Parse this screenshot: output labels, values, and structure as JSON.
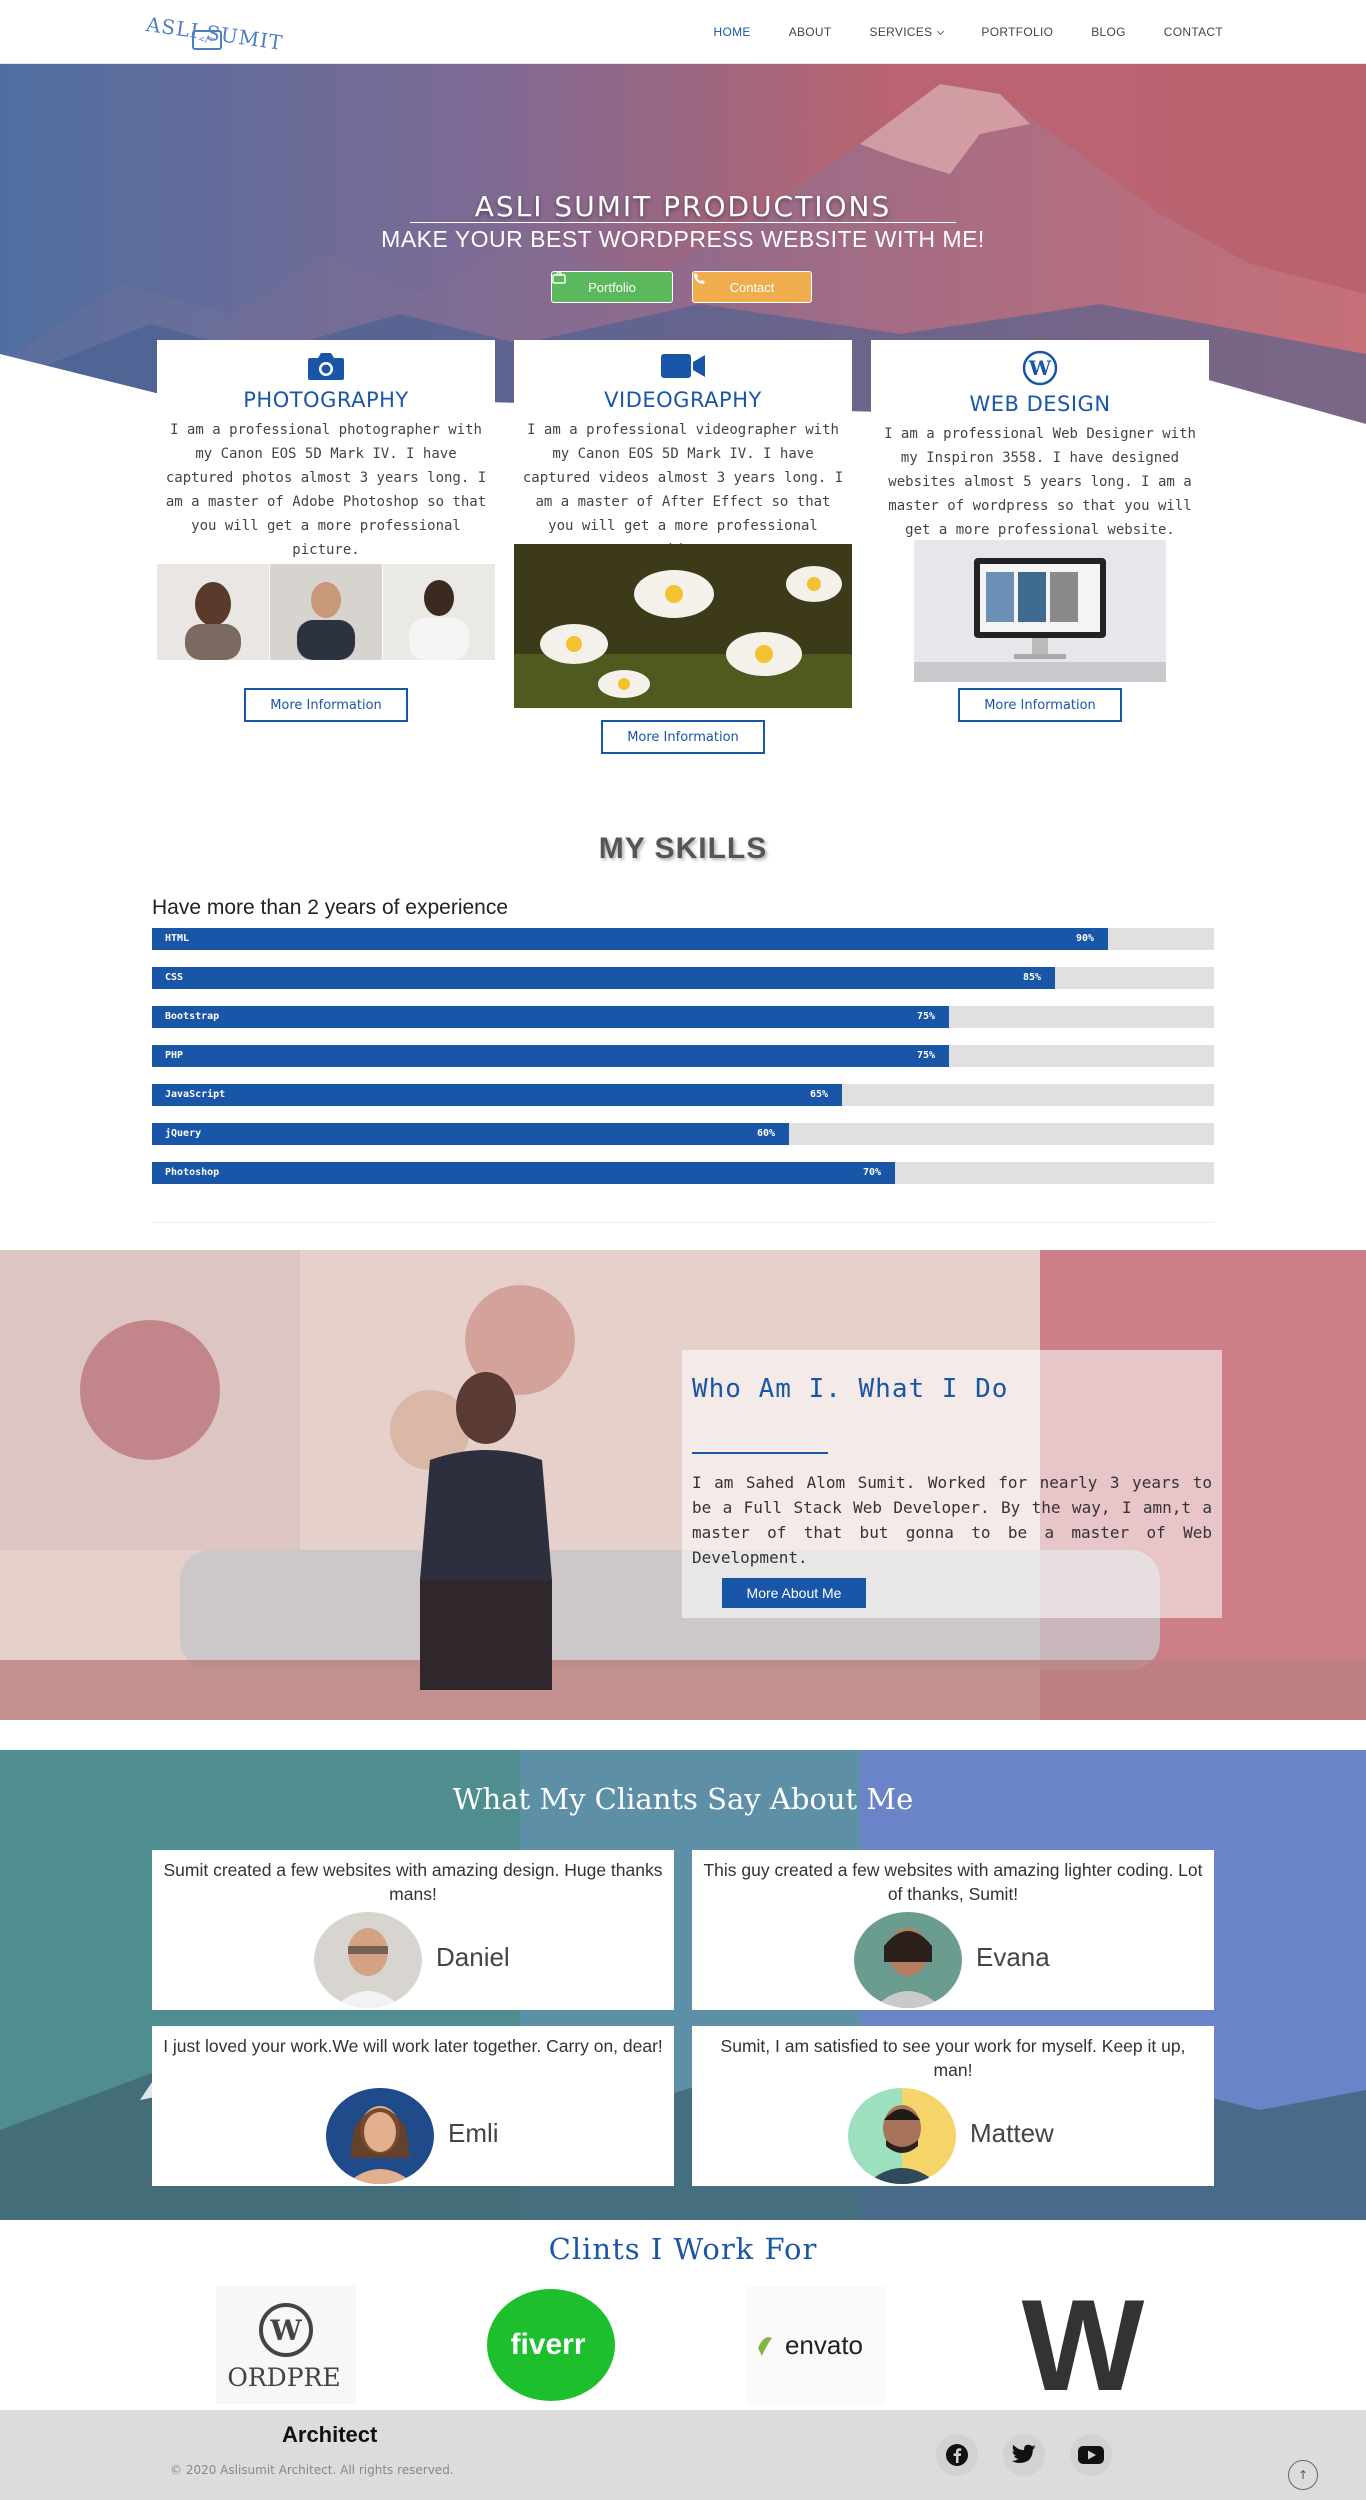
{
  "header": {
    "logo_text": "ASLI SUMIT",
    "logo_mark": "</>",
    "nav": [
      {
        "label": "HOME",
        "active": true
      },
      {
        "label": "ABOUT"
      },
      {
        "label": "SERVICES",
        "dropdown": true
      },
      {
        "label": "PORTFOLIO"
      },
      {
        "label": "BLOG"
      },
      {
        "label": "CONTACT"
      }
    ]
  },
  "hero": {
    "title": "ASLI SUMIT PRODUCTIONS",
    "subtitle": "MAKE YOUR BEST WORDPRESS WEBSITE WITH ME!",
    "portfolio_label": "Portfolio",
    "contact_label": "Contact"
  },
  "services": [
    {
      "icon": "camera-icon",
      "title": "PHOTOGRAPHY",
      "text": "I am a professional photographer with my Canon EOS 5D Mark IV. I have captured photos almost 3 years long. I am a master of Adobe Photoshop so that you will get a more professional picture.",
      "button": "More Information"
    },
    {
      "icon": "video-camera-icon",
      "title": "VIDEOGRAPHY",
      "text": "I am a professional videographer with my Canon EOS 5D Mark IV. I have captured videos almost 3 years long. I am a master of After Effect so that you will get a more professional video.",
      "button": "More Information"
    },
    {
      "icon": "wordpress-icon",
      "title": "WEB DESIGN",
      "text": "I am a professional Web Designer with my Inspiron 3558. I have designed websites almost 5 years long. I am a master of wordpress so that you will get a more professional website.",
      "button": "More Information"
    }
  ],
  "skills": {
    "title": "MY SKILLS",
    "subtitle": "Have more than 2 years of experience",
    "items": [
      {
        "name": "HTML",
        "percent": 90,
        "label": "90%"
      },
      {
        "name": "CSS",
        "percent": 85,
        "label": "85%"
      },
      {
        "name": "Bootstrap",
        "percent": 75,
        "label": "75%"
      },
      {
        "name": "PHP",
        "percent": 75,
        "label": "75%"
      },
      {
        "name": "JavaScript",
        "percent": 65,
        "label": "65%"
      },
      {
        "name": "jQuery",
        "percent": 60,
        "label": "60%"
      },
      {
        "name": "Photoshop",
        "percent": 70,
        "label": "70%"
      }
    ]
  },
  "about": {
    "title": "Who Am I. What I Do",
    "text": "I am Sahed Alom Sumit. Worked for nearly 3 years to be a Full Stack Web Developer. By the way, I amn,t a master of that but gonna to be a master of Web Development.",
    "button": "More About Me"
  },
  "testimonials": {
    "title": "What My Cliants Say About Me",
    "items": [
      {
        "quote": "Sumit created a few websites with amazing design. Huge thanks mans!",
        "name": "Daniel"
      },
      {
        "quote": "This guy created a few websites with amazing lighter coding. Lot of thanks, Sumit!",
        "name": "Evana"
      },
      {
        "quote": "I just loved your work.We will work later together. Carry on, dear!",
        "name": "Emli"
      },
      {
        "quote": "Sumit, I am satisfied to see your work for myself. Keep it up, man!",
        "name": "Mattew"
      }
    ]
  },
  "clients": {
    "title": "Clints I Work For",
    "logos": [
      {
        "name": "wordpress-logo",
        "text": "ORDPRE"
      },
      {
        "name": "fiverr-logo",
        "text": "fiverr"
      },
      {
        "name": "envato-logo",
        "text": "envato"
      },
      {
        "name": "webflow-logo",
        "text": "W"
      }
    ]
  },
  "footer": {
    "brand": "Architect",
    "copyright": "© 2020 Aslisumit Architect. All rights reserved.",
    "social": [
      "facebook-icon",
      "twitter-icon",
      "youtube-icon"
    ],
    "back_to_top": "↑"
  },
  "colors": {
    "primary": "#1a56a8",
    "success": "#5cb85c",
    "warning": "#f0ad4e",
    "footer_bg": "#dcdcdc"
  }
}
